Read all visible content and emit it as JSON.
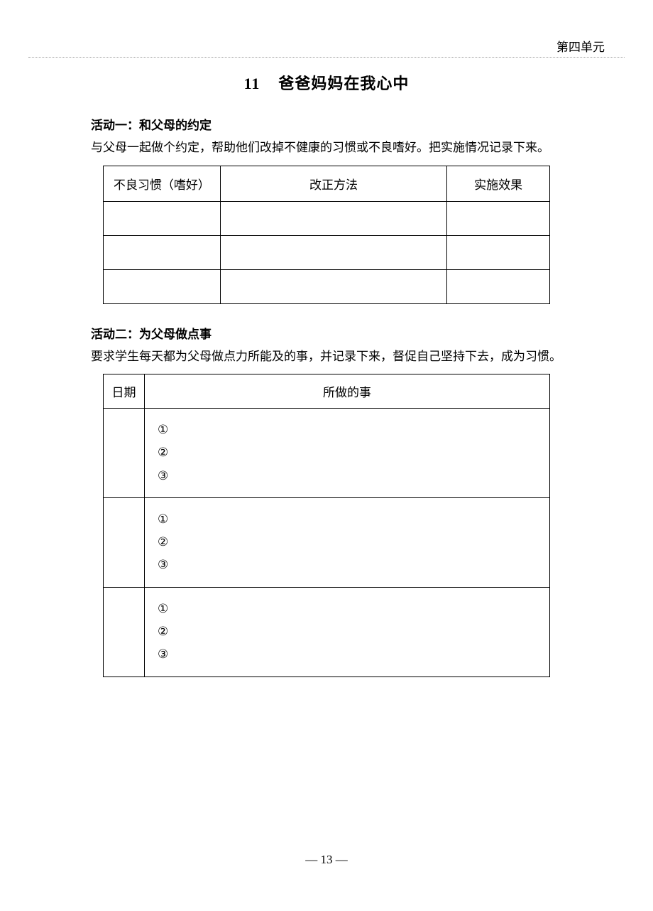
{
  "header": {
    "unit_label": "第四单元"
  },
  "title": {
    "number": "11",
    "text": "爸爸妈妈在我心中"
  },
  "activity1": {
    "heading": "活动一：和父母的约定",
    "description": "与父母一起做个约定，帮助他们改掉不健康的习惯或不良嗜好。把实施情况记录下来。",
    "table": {
      "headers": {
        "col1": "不良习惯（嗜好）",
        "col2": "改正方法",
        "col3": "实施效果"
      },
      "rows": [
        {
          "c1": "",
          "c2": "",
          "c3": ""
        },
        {
          "c1": "",
          "c2": "",
          "c3": ""
        },
        {
          "c1": "",
          "c2": "",
          "c3": ""
        }
      ]
    }
  },
  "activity2": {
    "heading": "活动二：为父母做点事",
    "description": "要求学生每天都为父母做点力所能及的事，并记录下来，督促自己坚持下去，成为习惯。",
    "table": {
      "headers": {
        "col1": "日期",
        "col2": "所做的事"
      },
      "rows": [
        {
          "date": "",
          "tasks": {
            "t1": "①",
            "t2": "②",
            "t3": "③"
          }
        },
        {
          "date": "",
          "tasks": {
            "t1": "①",
            "t2": "②",
            "t3": "③"
          }
        },
        {
          "date": "",
          "tasks": {
            "t1": "①",
            "t2": "②",
            "t3": "③"
          }
        }
      ]
    }
  },
  "footer": {
    "page_number": "— 13 —"
  }
}
